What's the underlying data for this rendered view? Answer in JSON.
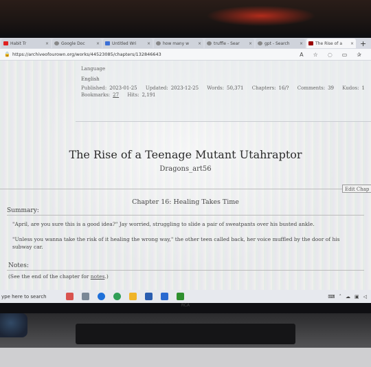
{
  "browser": {
    "tabs": [
      {
        "label": "Habit Tr",
        "icon": "youtube-icon",
        "color": "#e02020"
      },
      {
        "label": "Google Doc",
        "icon": "search-icon",
        "color": "#777777"
      },
      {
        "label": "Untitled Wri",
        "icon": "docs-icon",
        "color": "#3b6fd6"
      },
      {
        "label": "how many w",
        "icon": "search-icon",
        "color": "#777777"
      },
      {
        "label": "truffle - Sear",
        "icon": "search-icon",
        "color": "#777777"
      },
      {
        "label": "gpt - Search",
        "icon": "search-icon",
        "color": "#777777"
      },
      {
        "label": "The Rise of a",
        "icon": "ao3-icon",
        "color": "#990000",
        "active": true
      }
    ],
    "new_tab": "+",
    "url": "https://archiveofourown.org/works/44523085/chapters/132846643"
  },
  "work_meta": {
    "language_label": "Language",
    "language_value": "English",
    "published_label": "Published:",
    "published_value": "2023-01-25",
    "updated_label": "Updated:",
    "updated_value": "2023-12-25",
    "words_label": "Words:",
    "words_value": "50,371",
    "chapters_label": "Chapters:",
    "chapters_value": "16/?",
    "comments_label": "Comments:",
    "comments_value": "39",
    "kudos_label": "Kudos:",
    "kudos_value": "1",
    "bookmarks_label": "Bookmarks:",
    "bookmarks_value": "27",
    "hits_label": "Hits:",
    "hits_value": "2,191"
  },
  "work": {
    "title": "The Rise of a Teenage Mutant Utahraptor",
    "author": "Dragons_art56",
    "edit_label": "Edit Chap",
    "chapter_title": "Chapter 16: Healing Takes Time",
    "summary_heading": "Summary:",
    "summary_p1": "\"April, are you sure this is a good idea?\" Jay worried, struggling to slide a pair of sweatpants over his busted ankle.",
    "summary_p2": "\"Unless you wanna take the risk of it healing the wrong way,\" the other teen called back, her voice muffled by the door of his subway car.",
    "notes_heading": "Notes:",
    "notes_prefix": "(See the end of the chapter for ",
    "notes_link": "notes",
    "notes_suffix": ".)"
  },
  "taskbar": {
    "search_text": "ype here to search",
    "brand": "RCA"
  },
  "colors": {
    "accent_ao3": "#990000",
    "edge_blue": "#1e6fd9",
    "taskbar_bg": "#e7e9ee"
  }
}
